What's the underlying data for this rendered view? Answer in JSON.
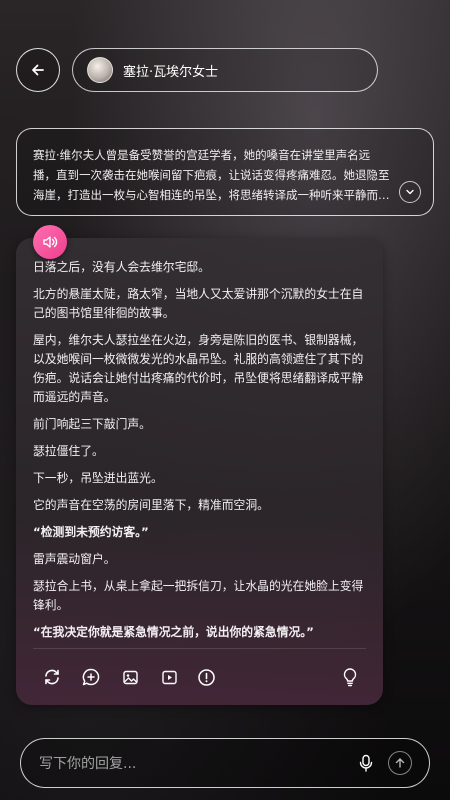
{
  "header": {
    "character_name": "塞拉·瓦埃尔女士"
  },
  "intro": {
    "text": "赛拉·维尔夫人曾是备受赞誉的宫廷学者，她的嗓音在讲堂里声名远播，直到一次袭击在她喉间留下疤痕，让说话变得疼痛难忍。她退隐至海崖，打造出一枚与心智相连的吊坠，将思绪转译成一种听来平静而遥远的声音。"
  },
  "message": {
    "paragraphs": [
      "日落之后，没有人会去维尔宅邸。",
      "北方的悬崖太陡，路太窄，当地人又太爱讲那个沉默的女士在自己的图书馆里徘徊的故事。",
      "屋内，维尔夫人瑟拉坐在火边，身旁是陈旧的医书、银制器械，以及她喉间一枚微微发光的水晶吊坠。礼服的高领遮住了其下的伤疤。说话会让她付出疼痛的代价时，吊坠便将思绪翻译成平静而遥远的声音。",
      "前门响起三下敲门声。",
      "瑟拉僵住了。",
      "下一秒，吊坠迸出蓝光。",
      "它的声音在空荡的房间里落下，精准而空洞。",
      "“检测到未预约访客。”",
      "雷声震动窗户。",
      "瑟拉合上书，从桌上拿起一把拆信刀，让水晶的光在她脸上变得锋利。",
      "“在我决定你就是紧急情况之前，说出你的紧急情况。”"
    ]
  },
  "input": {
    "placeholder": "写下你的回复..."
  },
  "icons": {
    "back": "arrow-left-icon",
    "expand": "chevron-down-icon",
    "speaker": "speaker-icon",
    "regenerate": "refresh-icon",
    "comment": "chat-plus-icon",
    "image": "image-icon",
    "video": "play-icon",
    "report": "alert-icon",
    "hint": "lightbulb-icon",
    "mic": "mic-icon",
    "send": "arrow-up-icon"
  },
  "colors": {
    "accent": "#ee3f8c"
  }
}
